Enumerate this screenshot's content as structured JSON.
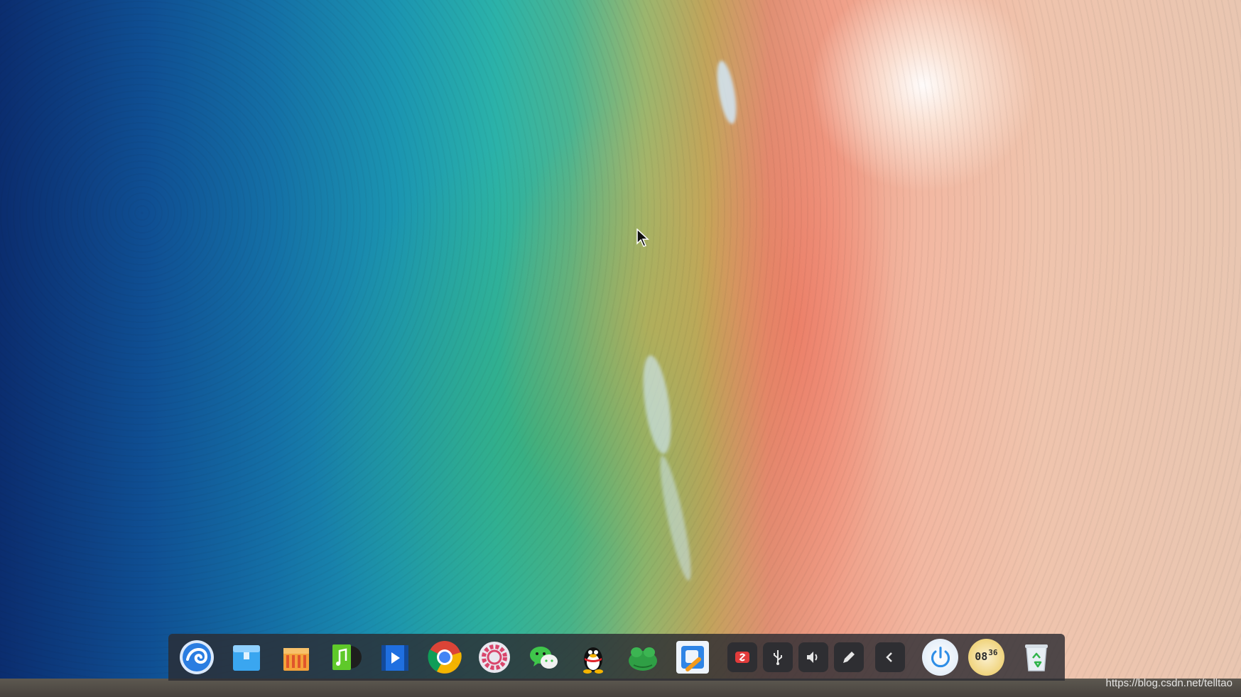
{
  "desktop": {
    "wallpaper": "beach aerial wallpaper"
  },
  "dock": {
    "apps": [
      {
        "name": "launcher-icon"
      },
      {
        "name": "file-manager-icon"
      },
      {
        "name": "app-store-icon"
      },
      {
        "name": "music-icon"
      },
      {
        "name": "video-player-icon"
      },
      {
        "name": "chrome-icon"
      },
      {
        "name": "settings-icon"
      },
      {
        "name": "wechat-icon"
      },
      {
        "name": "qq-penguin-icon"
      },
      {
        "name": "green-app-icon"
      },
      {
        "name": "window-app-icon"
      }
    ],
    "tray": [
      {
        "name": "input-method-icon"
      },
      {
        "name": "usb-icon"
      },
      {
        "name": "volume-icon"
      },
      {
        "name": "pen-icon"
      },
      {
        "name": "chevron-left-icon"
      }
    ],
    "clock": {
      "hour": "08",
      "minute": "36"
    }
  },
  "watermark": "https://blog.csdn.net/telltao",
  "colors": {
    "dock_bg": "#2c2c32",
    "accent_blue": "#2a7de1"
  }
}
